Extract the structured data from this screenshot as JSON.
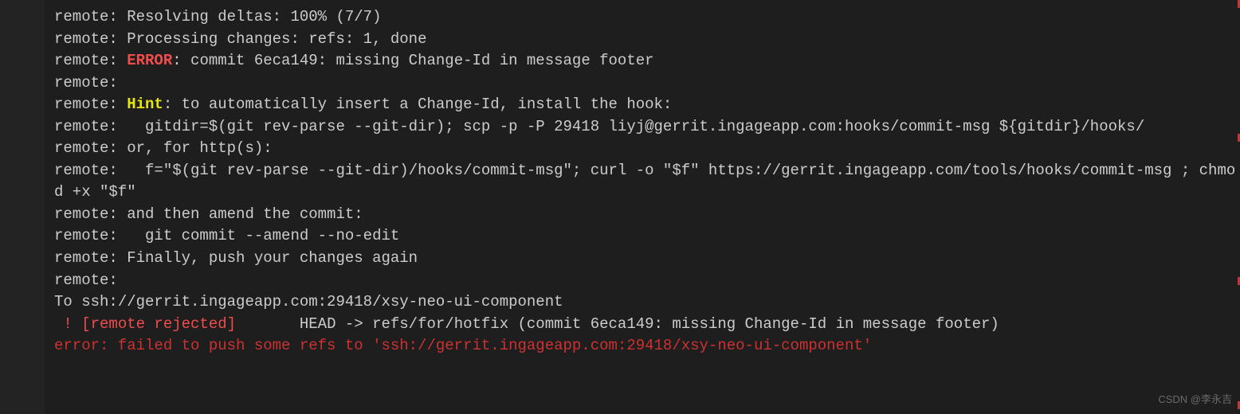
{
  "terminal": {
    "lines": [
      {
        "segments": [
          {
            "text": "remote: Resolving deltas: 100% (7/7)",
            "class": "gray"
          }
        ]
      },
      {
        "segments": [
          {
            "text": "remote: Processing changes: refs: 1, done",
            "class": "gray"
          }
        ]
      },
      {
        "segments": [
          {
            "text": "remote: ",
            "class": "gray"
          },
          {
            "text": "ERROR",
            "class": "error-red"
          },
          {
            "text": ": commit 6eca149: missing Change-Id in message footer",
            "class": "gray"
          }
        ]
      },
      {
        "segments": [
          {
            "text": "remote:",
            "class": "gray"
          }
        ]
      },
      {
        "segments": [
          {
            "text": "remote: ",
            "class": "gray"
          },
          {
            "text": "Hint",
            "class": "hint-yellow"
          },
          {
            "text": ": to automatically insert a Change-Id, install the hook:",
            "class": "gray"
          }
        ]
      },
      {
        "segments": [
          {
            "text": "remote:   gitdir=$(git rev-parse --git-dir); scp -p -P 29418 liyj@gerrit.ingageapp.com:hooks/commit-msg ${gitdir}/hooks/",
            "class": "gray"
          }
        ]
      },
      {
        "segments": [
          {
            "text": "remote: or, for http(s):",
            "class": "gray"
          }
        ]
      },
      {
        "segments": [
          {
            "text": "remote:   f=\"$(git rev-parse --git-dir)/hooks/commit-msg\"; curl -o \"$f\" https://gerrit.ingageapp.com/tools/hooks/commit-msg ; chmod +x \"$f\"",
            "class": "gray"
          }
        ]
      },
      {
        "segments": [
          {
            "text": "remote: and then amend the commit:",
            "class": "gray"
          }
        ]
      },
      {
        "segments": [
          {
            "text": "remote:   git commit --amend --no-edit",
            "class": "gray"
          }
        ]
      },
      {
        "segments": [
          {
            "text": "remote: Finally, push your changes again",
            "class": "gray"
          }
        ]
      },
      {
        "segments": [
          {
            "text": "remote:",
            "class": "gray"
          }
        ]
      },
      {
        "segments": [
          {
            "text": "To ssh://gerrit.ingageapp.com:29418/xsy-neo-ui-component",
            "class": "gray"
          }
        ]
      },
      {
        "segments": [
          {
            "text": " ! [remote rejected]",
            "class": "reject-red"
          },
          {
            "text": "       HEAD -> refs/for/hotfix (commit 6eca149: missing Change-Id in message footer)",
            "class": "gray"
          }
        ]
      },
      {
        "segments": [
          {
            "text": "error: failed to push some refs to 'ssh://gerrit.ingageapp.com:29418/xsy-neo-ui-component'",
            "class": "dark-red"
          }
        ]
      }
    ]
  },
  "watermark": "CSDN @李永吉"
}
